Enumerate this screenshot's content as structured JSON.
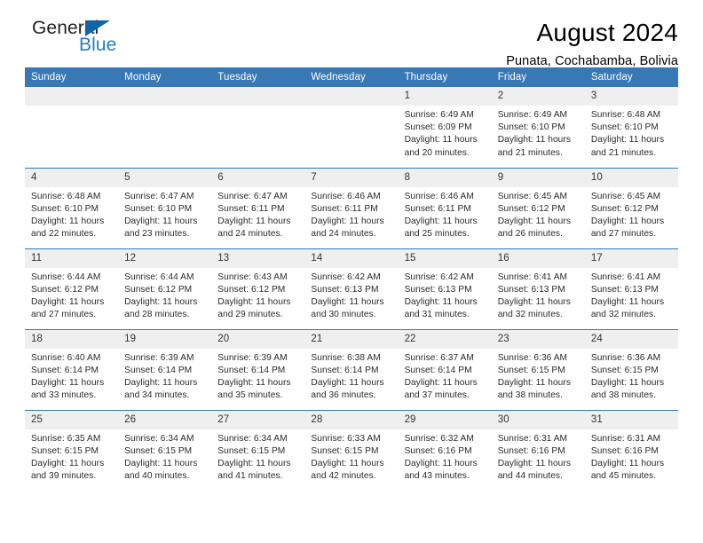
{
  "brand": {
    "name_part1": "General",
    "name_part2": "Blue",
    "triangle_color": "#1263a8",
    "blue": "#1f7fc4"
  },
  "header": {
    "title": "August 2024",
    "subtitle": "Punata, Cochabamba, Bolivia"
  },
  "theme": {
    "header_row_bg": "#3878b4",
    "daynum_bg": "#efefef",
    "cell_bg": "#ffffff",
    "text": "#2b2b2b"
  },
  "labels": {
    "sunrise_prefix": "Sunrise:",
    "sunset_prefix": "Sunset:",
    "daylight_prefix": "Daylight:"
  },
  "weekdays": [
    "Sunday",
    "Monday",
    "Tuesday",
    "Wednesday",
    "Thursday",
    "Friday",
    "Saturday"
  ],
  "weeks": [
    [
      {
        "day": "",
        "sunrise": "",
        "sunset": "",
        "daylight_line1": "",
        "daylight_line2": ""
      },
      {
        "day": "",
        "sunrise": "",
        "sunset": "",
        "daylight_line1": "",
        "daylight_line2": ""
      },
      {
        "day": "",
        "sunrise": "",
        "sunset": "",
        "daylight_line1": "",
        "daylight_line2": ""
      },
      {
        "day": "",
        "sunrise": "",
        "sunset": "",
        "daylight_line1": "",
        "daylight_line2": ""
      },
      {
        "day": "1",
        "sunrise": "Sunrise: 6:49 AM",
        "sunset": "Sunset: 6:09 PM",
        "daylight_line1": "Daylight: 11 hours",
        "daylight_line2": "and 20 minutes."
      },
      {
        "day": "2",
        "sunrise": "Sunrise: 6:49 AM",
        "sunset": "Sunset: 6:10 PM",
        "daylight_line1": "Daylight: 11 hours",
        "daylight_line2": "and 21 minutes."
      },
      {
        "day": "3",
        "sunrise": "Sunrise: 6:48 AM",
        "sunset": "Sunset: 6:10 PM",
        "daylight_line1": "Daylight: 11 hours",
        "daylight_line2": "and 21 minutes."
      }
    ],
    [
      {
        "day": "4",
        "sunrise": "Sunrise: 6:48 AM",
        "sunset": "Sunset: 6:10 PM",
        "daylight_line1": "Daylight: 11 hours",
        "daylight_line2": "and 22 minutes."
      },
      {
        "day": "5",
        "sunrise": "Sunrise: 6:47 AM",
        "sunset": "Sunset: 6:10 PM",
        "daylight_line1": "Daylight: 11 hours",
        "daylight_line2": "and 23 minutes."
      },
      {
        "day": "6",
        "sunrise": "Sunrise: 6:47 AM",
        "sunset": "Sunset: 6:11 PM",
        "daylight_line1": "Daylight: 11 hours",
        "daylight_line2": "and 24 minutes."
      },
      {
        "day": "7",
        "sunrise": "Sunrise: 6:46 AM",
        "sunset": "Sunset: 6:11 PM",
        "daylight_line1": "Daylight: 11 hours",
        "daylight_line2": "and 24 minutes."
      },
      {
        "day": "8",
        "sunrise": "Sunrise: 6:46 AM",
        "sunset": "Sunset: 6:11 PM",
        "daylight_line1": "Daylight: 11 hours",
        "daylight_line2": "and 25 minutes."
      },
      {
        "day": "9",
        "sunrise": "Sunrise: 6:45 AM",
        "sunset": "Sunset: 6:12 PM",
        "daylight_line1": "Daylight: 11 hours",
        "daylight_line2": "and 26 minutes."
      },
      {
        "day": "10",
        "sunrise": "Sunrise: 6:45 AM",
        "sunset": "Sunset: 6:12 PM",
        "daylight_line1": "Daylight: 11 hours",
        "daylight_line2": "and 27 minutes."
      }
    ],
    [
      {
        "day": "11",
        "sunrise": "Sunrise: 6:44 AM",
        "sunset": "Sunset: 6:12 PM",
        "daylight_line1": "Daylight: 11 hours",
        "daylight_line2": "and 27 minutes."
      },
      {
        "day": "12",
        "sunrise": "Sunrise: 6:44 AM",
        "sunset": "Sunset: 6:12 PM",
        "daylight_line1": "Daylight: 11 hours",
        "daylight_line2": "and 28 minutes."
      },
      {
        "day": "13",
        "sunrise": "Sunrise: 6:43 AM",
        "sunset": "Sunset: 6:12 PM",
        "daylight_line1": "Daylight: 11 hours",
        "daylight_line2": "and 29 minutes."
      },
      {
        "day": "14",
        "sunrise": "Sunrise: 6:42 AM",
        "sunset": "Sunset: 6:13 PM",
        "daylight_line1": "Daylight: 11 hours",
        "daylight_line2": "and 30 minutes."
      },
      {
        "day": "15",
        "sunrise": "Sunrise: 6:42 AM",
        "sunset": "Sunset: 6:13 PM",
        "daylight_line1": "Daylight: 11 hours",
        "daylight_line2": "and 31 minutes."
      },
      {
        "day": "16",
        "sunrise": "Sunrise: 6:41 AM",
        "sunset": "Sunset: 6:13 PM",
        "daylight_line1": "Daylight: 11 hours",
        "daylight_line2": "and 32 minutes."
      },
      {
        "day": "17",
        "sunrise": "Sunrise: 6:41 AM",
        "sunset": "Sunset: 6:13 PM",
        "daylight_line1": "Daylight: 11 hours",
        "daylight_line2": "and 32 minutes."
      }
    ],
    [
      {
        "day": "18",
        "sunrise": "Sunrise: 6:40 AM",
        "sunset": "Sunset: 6:14 PM",
        "daylight_line1": "Daylight: 11 hours",
        "daylight_line2": "and 33 minutes."
      },
      {
        "day": "19",
        "sunrise": "Sunrise: 6:39 AM",
        "sunset": "Sunset: 6:14 PM",
        "daylight_line1": "Daylight: 11 hours",
        "daylight_line2": "and 34 minutes."
      },
      {
        "day": "20",
        "sunrise": "Sunrise: 6:39 AM",
        "sunset": "Sunset: 6:14 PM",
        "daylight_line1": "Daylight: 11 hours",
        "daylight_line2": "and 35 minutes."
      },
      {
        "day": "21",
        "sunrise": "Sunrise: 6:38 AM",
        "sunset": "Sunset: 6:14 PM",
        "daylight_line1": "Daylight: 11 hours",
        "daylight_line2": "and 36 minutes."
      },
      {
        "day": "22",
        "sunrise": "Sunrise: 6:37 AM",
        "sunset": "Sunset: 6:14 PM",
        "daylight_line1": "Daylight: 11 hours",
        "daylight_line2": "and 37 minutes."
      },
      {
        "day": "23",
        "sunrise": "Sunrise: 6:36 AM",
        "sunset": "Sunset: 6:15 PM",
        "daylight_line1": "Daylight: 11 hours",
        "daylight_line2": "and 38 minutes."
      },
      {
        "day": "24",
        "sunrise": "Sunrise: 6:36 AM",
        "sunset": "Sunset: 6:15 PM",
        "daylight_line1": "Daylight: 11 hours",
        "daylight_line2": "and 38 minutes."
      }
    ],
    [
      {
        "day": "25",
        "sunrise": "Sunrise: 6:35 AM",
        "sunset": "Sunset: 6:15 PM",
        "daylight_line1": "Daylight: 11 hours",
        "daylight_line2": "and 39 minutes."
      },
      {
        "day": "26",
        "sunrise": "Sunrise: 6:34 AM",
        "sunset": "Sunset: 6:15 PM",
        "daylight_line1": "Daylight: 11 hours",
        "daylight_line2": "and 40 minutes."
      },
      {
        "day": "27",
        "sunrise": "Sunrise: 6:34 AM",
        "sunset": "Sunset: 6:15 PM",
        "daylight_line1": "Daylight: 11 hours",
        "daylight_line2": "and 41 minutes."
      },
      {
        "day": "28",
        "sunrise": "Sunrise: 6:33 AM",
        "sunset": "Sunset: 6:15 PM",
        "daylight_line1": "Daylight: 11 hours",
        "daylight_line2": "and 42 minutes."
      },
      {
        "day": "29",
        "sunrise": "Sunrise: 6:32 AM",
        "sunset": "Sunset: 6:16 PM",
        "daylight_line1": "Daylight: 11 hours",
        "daylight_line2": "and 43 minutes."
      },
      {
        "day": "30",
        "sunrise": "Sunrise: 6:31 AM",
        "sunset": "Sunset: 6:16 PM",
        "daylight_line1": "Daylight: 11 hours",
        "daylight_line2": "and 44 minutes."
      },
      {
        "day": "31",
        "sunrise": "Sunrise: 6:31 AM",
        "sunset": "Sunset: 6:16 PM",
        "daylight_line1": "Daylight: 11 hours",
        "daylight_line2": "and 45 minutes."
      }
    ]
  ]
}
